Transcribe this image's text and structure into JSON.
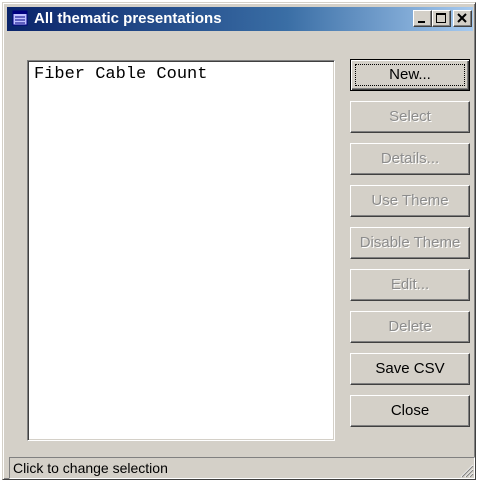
{
  "window": {
    "title": "All thematic presentations",
    "titlebar_colors": [
      "#0a246a",
      "#a6caf0"
    ]
  },
  "list": {
    "items": [
      "Fiber Cable Count"
    ]
  },
  "buttons": {
    "new": {
      "label": "New...",
      "enabled": true,
      "default": true
    },
    "select": {
      "label": "Select",
      "enabled": false
    },
    "details": {
      "label": "Details...",
      "enabled": false
    },
    "use_theme": {
      "label": "Use Theme",
      "enabled": false
    },
    "disable_theme": {
      "label": "Disable Theme",
      "enabled": false
    },
    "edit": {
      "label": "Edit...",
      "enabled": false
    },
    "delete": {
      "label": "Delete",
      "enabled": false
    },
    "save_csv": {
      "label": "Save CSV",
      "enabled": true
    },
    "close": {
      "label": "Close",
      "enabled": true
    }
  },
  "statusbar": {
    "text": "Click to change selection"
  },
  "icons": {
    "title": "app-window-icon",
    "minimize": "minimize-icon",
    "maximize": "maximize-icon",
    "close": "close-icon",
    "grip": "resize-grip-icon"
  }
}
